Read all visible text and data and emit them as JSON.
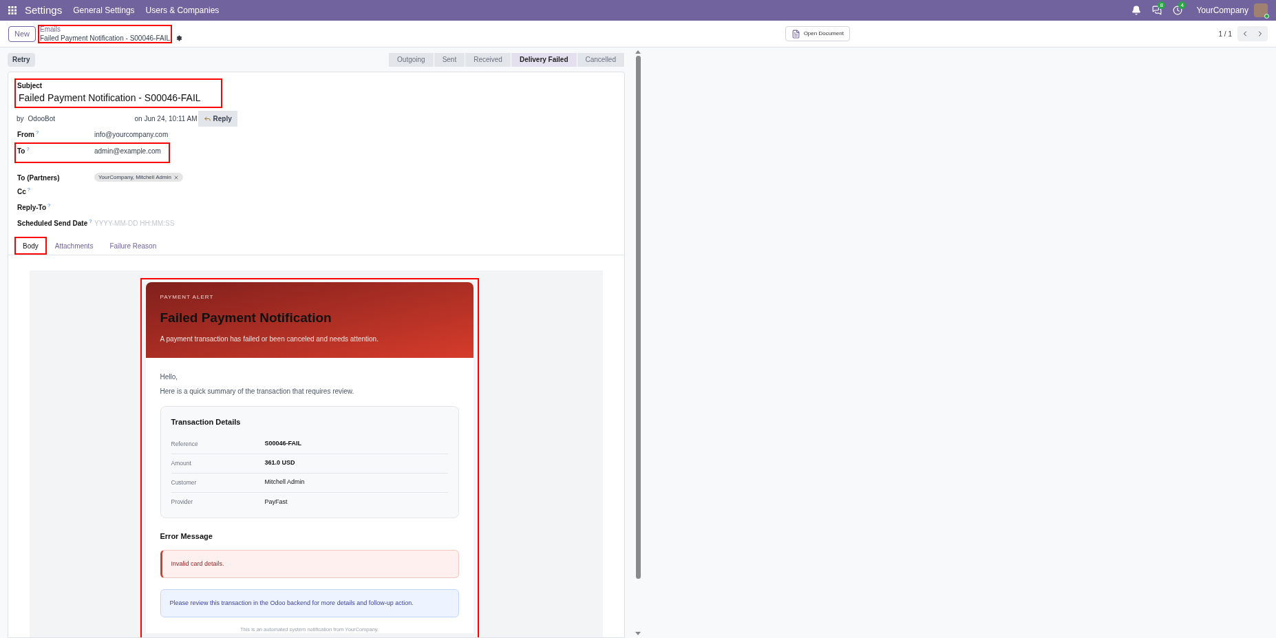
{
  "navbar": {
    "app": "Settings",
    "menus": [
      "General Settings",
      "Users & Companies"
    ],
    "messages_badge": "8",
    "activities_badge": "4",
    "company": "YourCompany"
  },
  "control_panel": {
    "new_button": "New",
    "breadcrumb": "Emails",
    "record_title": "Failed Payment Notification - S00046-FAIL",
    "highlighted": true,
    "open_document": "Open Document",
    "pager": "1 / 1"
  },
  "status_bar": {
    "buttons": [
      "Retry"
    ],
    "stages": [
      {
        "label": "Outgoing",
        "selected": false
      },
      {
        "label": "Sent",
        "selected": false
      },
      {
        "label": "Received",
        "selected": false
      },
      {
        "label": "Delivery Failed",
        "selected": true
      },
      {
        "label": "Cancelled",
        "selected": false
      }
    ]
  },
  "form": {
    "subject_label": "Subject",
    "subject": "Failed Payment Notification - S00046-FAIL",
    "subject_highlighted": true,
    "author_prefix": "by",
    "author": "OdooBot",
    "date": "on Jun 24, 10:11 AM",
    "reply_button": "Reply",
    "fields": [
      {
        "kind": "text",
        "label": "From",
        "help": "?",
        "value": "info@yourcompany.com",
        "highlighted": false
      },
      {
        "kind": "text",
        "label": "To",
        "help": "?",
        "value": "admin@example.com",
        "highlighted": true
      },
      {
        "kind": "tags",
        "label": "To (Partners)",
        "tags": [
          "YourCompany, Mitchell Admin"
        ],
        "highlighted": false
      },
      {
        "kind": "text",
        "label": "Cc",
        "help": "?",
        "highlighted": false
      },
      {
        "kind": "text",
        "label": "Reply-To",
        "help": "?",
        "highlighted": false
      },
      {
        "kind": "date",
        "label": "Scheduled Send Date",
        "help": "?",
        "placeholder": "YYYY-MM-DD HH:MM:SS",
        "highlighted": false
      }
    ],
    "tabs": [
      {
        "label": "Body",
        "selected": true,
        "highlighted": true
      },
      {
        "label": "Attachments",
        "selected": false,
        "highlighted": false
      },
      {
        "label": "Failure Reason",
        "selected": false,
        "highlighted": false
      }
    ]
  },
  "email": {
    "highlighted": true,
    "eyebrow": "PAYMENT ALERT",
    "title": "Failed Payment Notification",
    "subtitle": "A payment transaction has failed or been canceled and needs attention.",
    "greeting": "Hello,",
    "intro": "Here is a quick summary of the transaction that requires review.",
    "details_title": "Transaction Details",
    "details": [
      {
        "label": "Reference",
        "value": "S00046-FAIL",
        "bold": true
      },
      {
        "label": "Amount",
        "value": "361.0 USD",
        "bold": true
      },
      {
        "label": "Customer",
        "value": "Mitchell Admin",
        "bold": false
      },
      {
        "label": "Provider",
        "value": "PayFast",
        "bold": false
      }
    ],
    "error_title": "Error Message",
    "error": "Invalid card details.",
    "note": "Please review this transaction in the Odoo backend for more details and follow-up action.",
    "footer": "This is an automated system notification from YourCompany."
  }
}
